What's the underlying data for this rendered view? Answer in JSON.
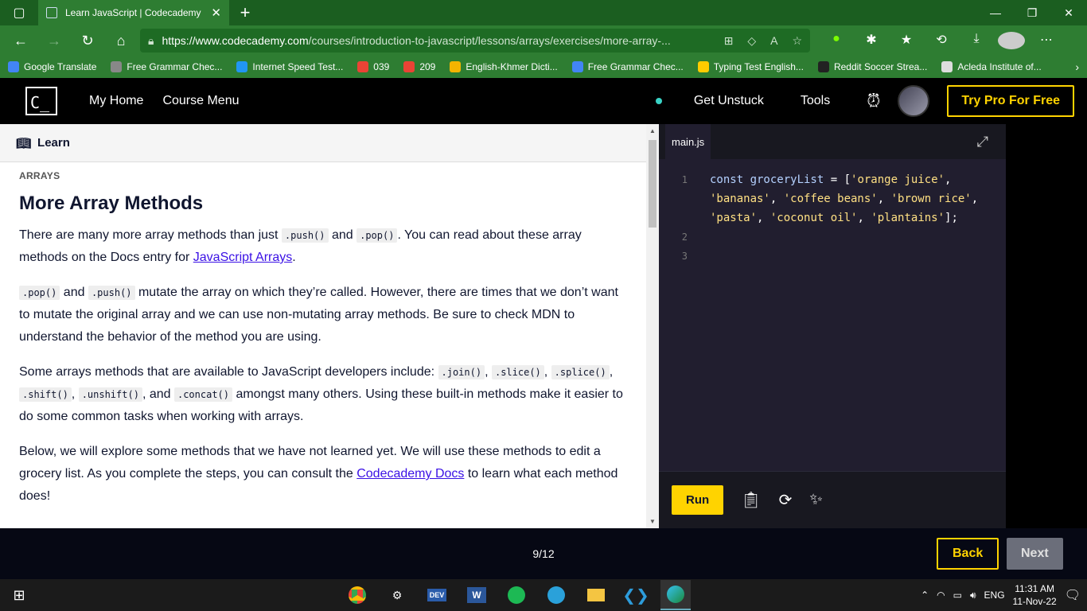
{
  "browser": {
    "tab_title": "Learn JavaScript | Codecademy",
    "url_host": "https://www.codecademy.com",
    "url_path": "/courses/introduction-to-javascript/lessons/arrays/exercises/more-array-...",
    "bookmarks": [
      {
        "label": "Google Translate",
        "color": "#4285f4"
      },
      {
        "label": "Free Grammar Chec...",
        "color": "#888888"
      },
      {
        "label": "Internet Speed Test...",
        "color": "#2196f3"
      },
      {
        "label": "039",
        "color": "#ea4335"
      },
      {
        "label": "209",
        "color": "#ea4335"
      },
      {
        "label": "English-Khmer Dicti...",
        "color": "#f4b400"
      },
      {
        "label": "Free Grammar Chec...",
        "color": "#4285f4"
      },
      {
        "label": "Typing Test English...",
        "color": "#ffcc00"
      },
      {
        "label": "Reddit Soccer Strea...",
        "color": "#222222"
      },
      {
        "label": "Acleda Institute of...",
        "color": "#dddddd"
      }
    ]
  },
  "header": {
    "logo": "C_",
    "my_home": "My Home",
    "course_menu": "Course Menu",
    "get_unstuck": "Get Unstuck",
    "tools": "Tools",
    "try_pro": "Try Pro For Free"
  },
  "learn": {
    "panel_label": "Learn",
    "kicker": "ARRAYS",
    "title": "More Array Methods",
    "p1": {
      "a": "There are many more array methods than just ",
      "code1": ".push()",
      "b": " and ",
      "code2": ".pop()",
      "c": ". You can read about these array methods on the Docs entry for ",
      "link": "JavaScript Arrays",
      "d": "."
    },
    "p2": {
      "code1": ".pop()",
      "a": " and ",
      "code2": ".push()",
      "b": " mutate the array on which they’re called. However, there are times that we don’t want to mutate the original array and we can use non-mutating array methods. Be sure to check MDN to understand the behavior of the method you are using."
    },
    "p3": {
      "a": "Some arrays methods that are available to JavaScript developers include: ",
      "code1": ".join()",
      "sep1": ", ",
      "code2": ".slice()",
      "sep2": ", ",
      "code3": ".splice()",
      "sep3": ", ",
      "code4": ".shift()",
      "sep4": ", ",
      "code5": ".unshift()",
      "sep5": ", and ",
      "code6": ".concat()",
      "b": " amongst many others. Using these built-in methods make it easier to do some common tasks when working with arrays."
    },
    "p4": {
      "a": "Below, we will explore some methods that we have not learned yet. We will use these methods to edit a grocery list. As you complete the steps, you can consult the ",
      "link": "Codecademy Docs",
      "b": " to learn what each method does!"
    }
  },
  "editor": {
    "file_tab": "main.js",
    "lines": [
      {
        "num": "1",
        "code": "const groceryList = ['orange juice',"
      },
      {
        "num": "",
        "code": "'bananas', 'coffee beans', 'brown rice',"
      },
      {
        "num": "",
        "code": "'pasta', 'coconut oil', 'plantains'];"
      },
      {
        "num": "2",
        "code": ""
      },
      {
        "num": "3",
        "code": ""
      }
    ],
    "run_label": "Run"
  },
  "footer": {
    "progress": "9/12",
    "back": "Back",
    "next": "Next"
  },
  "taskbar": {
    "lang": "ENG",
    "time": "11:31 AM",
    "date": "11-Nov-22"
  }
}
